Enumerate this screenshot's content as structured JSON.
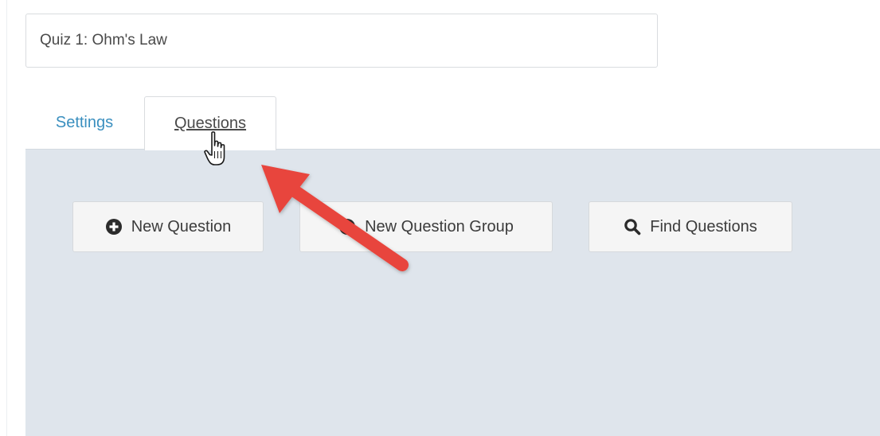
{
  "quiz": {
    "title_value": "Quiz 1: Ohm's Law"
  },
  "tabs": [
    {
      "label": "Settings",
      "active": false
    },
    {
      "label": "Questions",
      "active": true
    }
  ],
  "actions": {
    "new_question_label": "New Question",
    "new_question_group_label": "New Question Group",
    "find_questions_label": "Find Questions"
  },
  "icons": {
    "new_question": "plus-circle-icon",
    "new_question_group": "plus-circle-icon",
    "find_questions": "search-icon",
    "annotation": "red-arrow-icon",
    "pointer": "hand-pointer-icon"
  },
  "colors": {
    "panel_background": "#dfe5ec",
    "tab_link": "#3a8fbf",
    "annotation_arrow": "#e8453c",
    "button_background": "#f5f5f5",
    "text": "#3c3c3c"
  }
}
